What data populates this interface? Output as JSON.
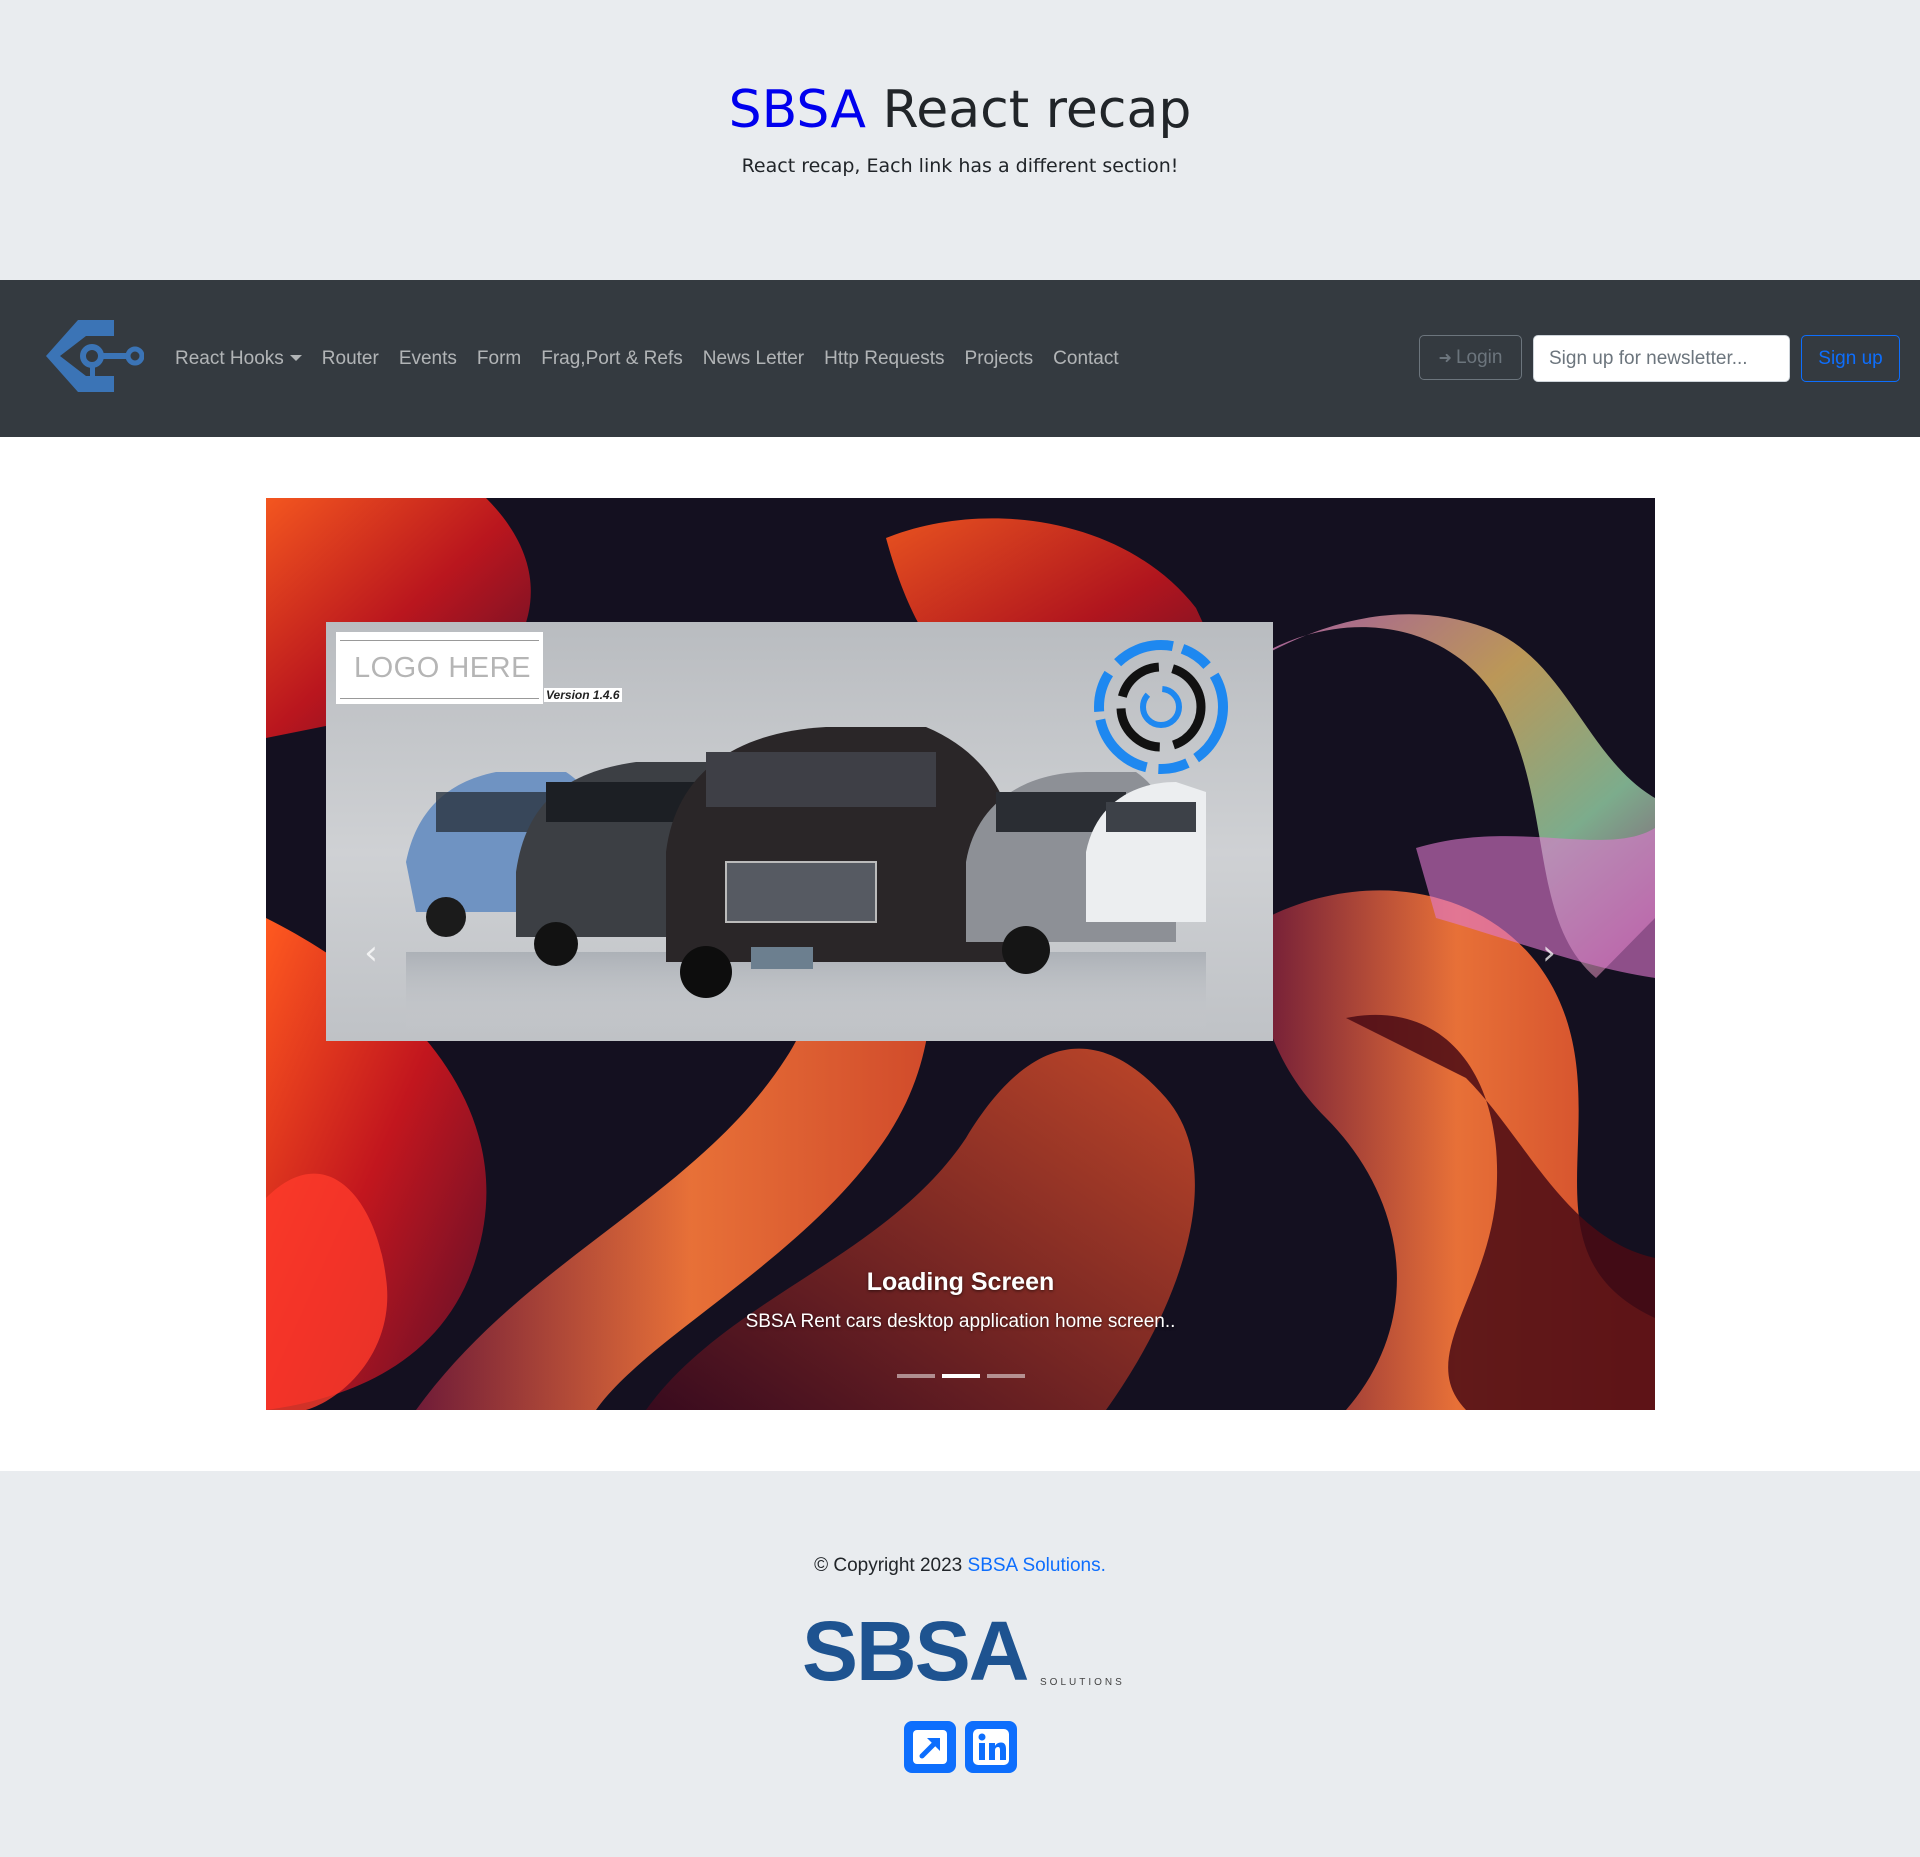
{
  "header": {
    "brand": "SBSA",
    "title_rest": "React recap",
    "subtitle": "React recap, Each link has a different section!"
  },
  "navbar": {
    "logo_icon": "key-diamond-logo-icon",
    "links": [
      {
        "label": "React Hooks",
        "dropdown": true
      },
      {
        "label": "Router"
      },
      {
        "label": "Events"
      },
      {
        "label": "Form"
      },
      {
        "label": "Frag,Port & Refs"
      },
      {
        "label": "News Letter"
      },
      {
        "label": "Http Requests"
      },
      {
        "label": "Projects"
      },
      {
        "label": "Contact"
      }
    ],
    "login_label": "Login",
    "newsletter_placeholder": "Sign up for newsletter...",
    "signup_label": "Sign up",
    "colors": {
      "bg": "#343a40",
      "primary": "#0d6efd",
      "secondary": "#6c757d"
    }
  },
  "carousel": {
    "slide": {
      "logo_text": "LOGO HERE",
      "version": "Version 1.4.6",
      "caption_title": "Loading Screen",
      "caption_text": "SBSA Rent cars desktop application home screen.."
    },
    "indicators": 3,
    "active_index": 1,
    "prev_icon": "chevron-left-icon",
    "next_icon": "chevron-right-icon"
  },
  "footer": {
    "copyright_prefix": "© Copyright 2023 ",
    "company_link": "SBSA Solutions.",
    "logo_big": "SBSA",
    "logo_small": "SOLUTIONS",
    "socials": [
      {
        "icon": "external-link-icon"
      },
      {
        "icon": "linkedin-icon"
      }
    ]
  }
}
